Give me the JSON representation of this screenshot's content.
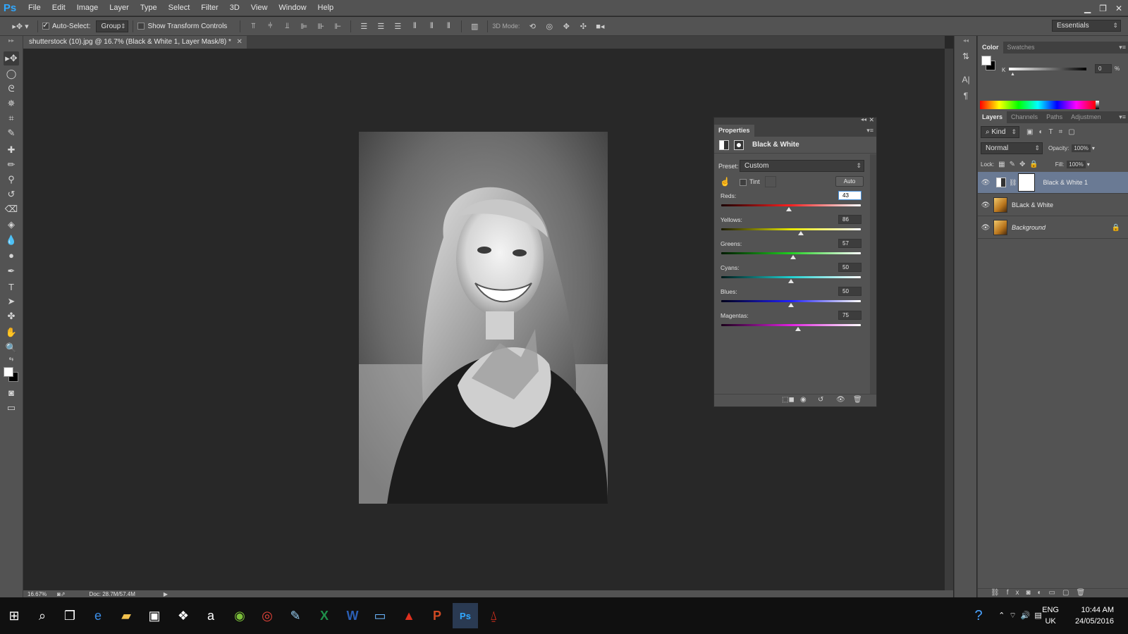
{
  "app": {
    "logo": "Ps",
    "menu": [
      "File",
      "Edit",
      "Image",
      "Layer",
      "Type",
      "Select",
      "Filter",
      "3D",
      "View",
      "Window",
      "Help"
    ],
    "window_controls": [
      "minimize-icon",
      "restore-icon",
      "close-icon"
    ]
  },
  "options": {
    "auto_select_label": "Auto-Select:",
    "auto_select_checked": true,
    "group_value": "Group",
    "show_transform_label": "Show Transform Controls",
    "show_transform_checked": false,
    "three_d_mode_label": "3D Mode:",
    "workspace": "Essentials"
  },
  "document": {
    "tab_title": "shutterstock (10).jpg @ 16.7% (Black & White 1, Layer Mask/8) *",
    "zoom": "16.67%",
    "doc_info": "Doc: 28.7M/57.4M"
  },
  "color_panel": {
    "tabs": [
      "Color",
      "Swatches"
    ],
    "k_label": "K",
    "k_value": "0",
    "k_unit": "%"
  },
  "layers_panel": {
    "tabs": [
      "Layers",
      "Channels",
      "Paths",
      "Adjustmen"
    ],
    "kind_filter": "Kind",
    "blend_mode": "Normal",
    "opacity_label": "Opacity:",
    "opacity_value": "100%",
    "lock_label": "Lock:",
    "fill_label": "Fill:",
    "fill_value": "100%",
    "layers": [
      {
        "name": "Black & White 1",
        "visible": true,
        "selected": true,
        "type": "adjustment"
      },
      {
        "name": "BLack & White",
        "visible": true,
        "selected": false,
        "type": "pixel"
      },
      {
        "name": "Background",
        "visible": true,
        "selected": false,
        "type": "pixel",
        "locked": true
      }
    ]
  },
  "properties": {
    "tab": "Properties",
    "title": "Black & White",
    "preset_label": "Preset:",
    "preset_value": "Custom",
    "tint_label": "Tint",
    "tint_checked": false,
    "auto_label": "Auto",
    "sliders": [
      {
        "label": "Reds:",
        "value": "43",
        "level": 43,
        "min": -200,
        "max": 300,
        "gradient": "linear-gradient(to right,#1a0000,#ff2020,#ffffff)",
        "editing": true
      },
      {
        "label": "Yellows:",
        "value": "86",
        "level": 86,
        "min": -200,
        "max": 300,
        "gradient": "linear-gradient(to right,#1a1a00,#e8e800,#ffffff)",
        "editing": false
      },
      {
        "label": "Greens:",
        "value": "57",
        "level": 57,
        "min": -200,
        "max": 300,
        "gradient": "linear-gradient(to right,#001a00,#20d020,#ffffff)",
        "editing": false
      },
      {
        "label": "Cyans:",
        "value": "50",
        "level": 50,
        "min": -200,
        "max": 300,
        "gradient": "linear-gradient(to right,#001a1a,#20d0d0,#ffffff)",
        "editing": false
      },
      {
        "label": "Blues:",
        "value": "50",
        "level": 50,
        "min": -200,
        "max": 300,
        "gradient": "linear-gradient(to right,#00001a,#2020ff,#ffffff)",
        "editing": false
      },
      {
        "label": "Magentas:",
        "value": "75",
        "level": 75,
        "min": -200,
        "max": 300,
        "gradient": "linear-gradient(to right,#1a001a,#e020e0,#ffffff)",
        "editing": false
      }
    ]
  },
  "taskbar": {
    "apps": [
      "windows-start-icon",
      "search-icon",
      "task-view-icon",
      "edge-icon",
      "file-explorer-icon",
      "store-icon",
      "dropbox-icon",
      "amazon-icon",
      "tripadvisor-icon",
      "chrome-icon",
      "paint-icon",
      "excel-icon",
      "word-icon",
      "scanner-icon",
      "acrobat-pro-icon",
      "powerpoint-icon",
      "photoshop-icon",
      "acrobat-reader-icon"
    ],
    "language_line1": "ENG",
    "language_line2": "UK",
    "time": "10:44 AM",
    "date": "24/05/2016"
  }
}
